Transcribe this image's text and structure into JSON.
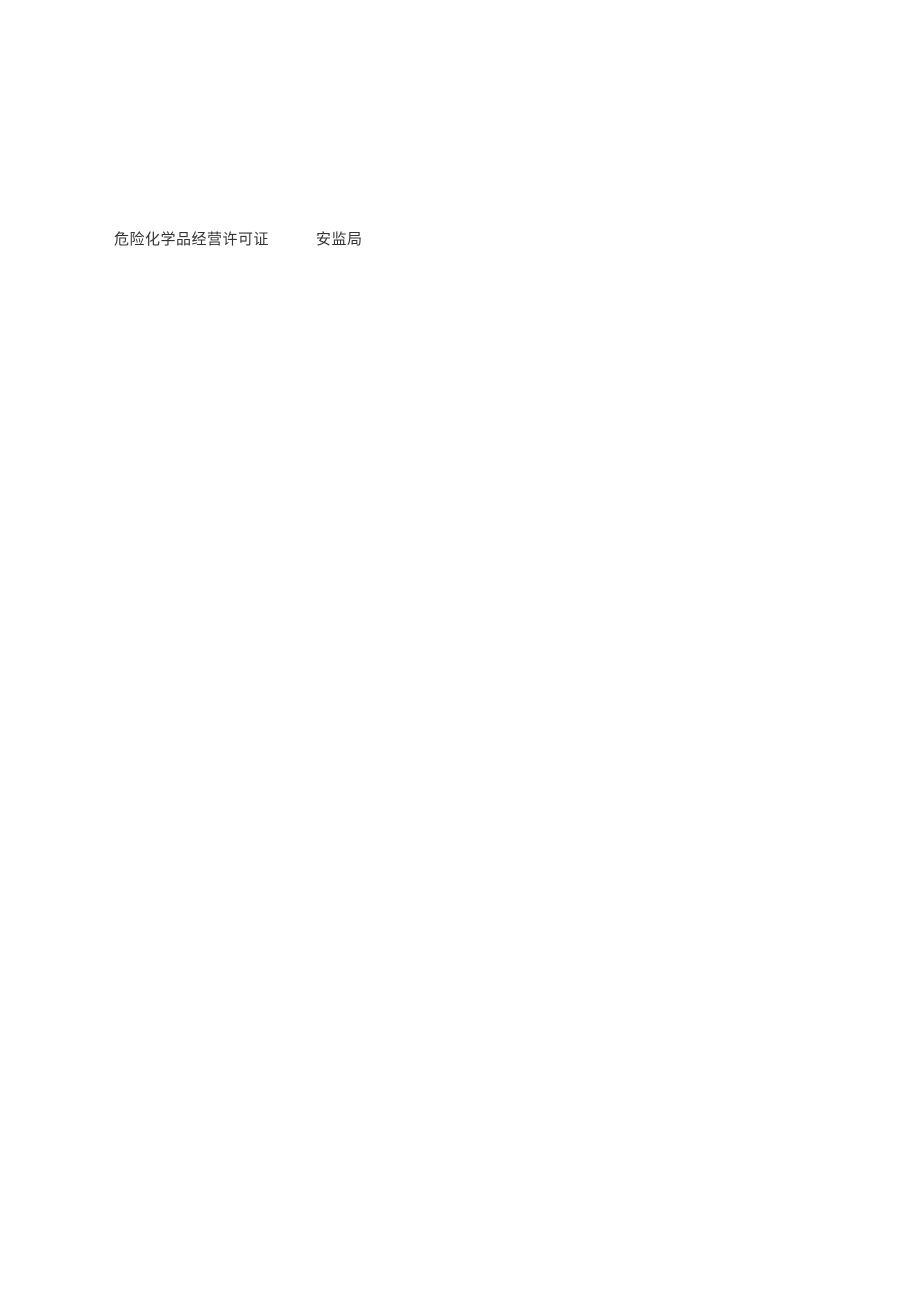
{
  "document": {
    "col1": "危险化学品经营许可证",
    "col2": "安监局"
  }
}
